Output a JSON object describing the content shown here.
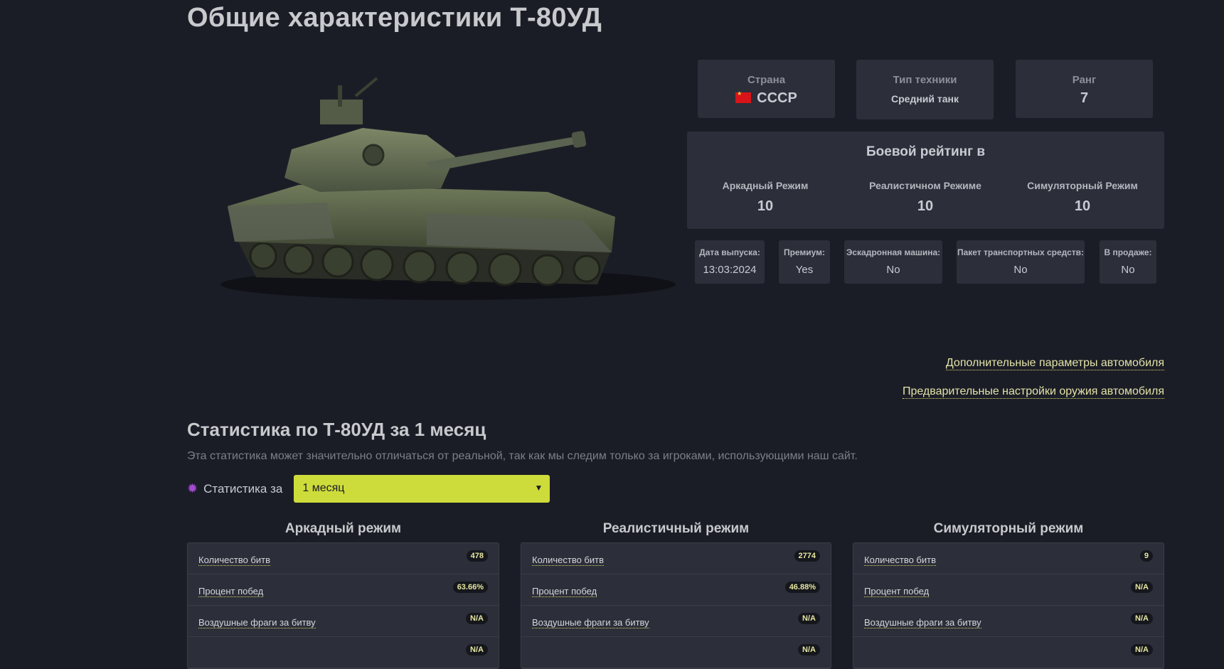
{
  "page_title": "Общие характеристики Т-80УД",
  "country": {
    "label": "Страна",
    "value": "СССР",
    "flag_color": "#d7141a"
  },
  "vehicle_type": {
    "label": "Тип техники",
    "value": "Средний танк"
  },
  "rank": {
    "label": "Ранг",
    "value": "7"
  },
  "battle_rating": {
    "title": "Боевой рейтинг в",
    "modes": [
      {
        "label": "Аркадный Режим",
        "value": "10"
      },
      {
        "label": "Реалистичном Режиме",
        "value": "10"
      },
      {
        "label": "Симуляторный Режим",
        "value": "10"
      }
    ]
  },
  "meta": [
    {
      "label": "Дата выпуска:",
      "value": "13:03:2024"
    },
    {
      "label": "Премиум:",
      "value": "Yes"
    },
    {
      "label": "Эскадронная машина:",
      "value": "No"
    },
    {
      "label": "Пакет транспортных средств:",
      "value": "No"
    },
    {
      "label": "В продаже:",
      "value": "No"
    }
  ],
  "links": {
    "extra_params": "Дополнительные параметры автомобиля",
    "weapon_presets": "Предварительные настройки оружия автомобиля"
  },
  "stats": {
    "title": "Статистика по Т-80УД за 1 месяц",
    "description": "Эта статистика может значительно отличаться от реальной, так как мы следим только за игроками, использующими наш сайт.",
    "period_label": "Статистика за",
    "period_value": "1 месяц",
    "columns": [
      {
        "title": "Аркадный режим",
        "rows": [
          {
            "name": "Количество битв",
            "value": "478"
          },
          {
            "name": "Процент побед",
            "value": "63.66%"
          },
          {
            "name": "Воздушные фраги за битву",
            "value": "N/A"
          },
          {
            "name": "",
            "value": "N/A"
          }
        ]
      },
      {
        "title": "Реалистичный режим",
        "rows": [
          {
            "name": "Количество битв",
            "value": "2774"
          },
          {
            "name": "Процент побед",
            "value": "46.88%"
          },
          {
            "name": "Воздушные фраги за битву",
            "value": "N/A"
          },
          {
            "name": "",
            "value": "N/A"
          }
        ]
      },
      {
        "title": "Симуляторный режим",
        "rows": [
          {
            "name": "Количество битв",
            "value": "9"
          },
          {
            "name": "Процент побед",
            "value": "N/A"
          },
          {
            "name": "Воздушные фраги за битву",
            "value": "N/A"
          },
          {
            "name": "",
            "value": "N/A"
          }
        ]
      }
    ]
  },
  "colors": {
    "background": "#1b1d26",
    "card": "#2c2e39",
    "accent": "#cddc3a",
    "link": "#e3e3a8"
  }
}
